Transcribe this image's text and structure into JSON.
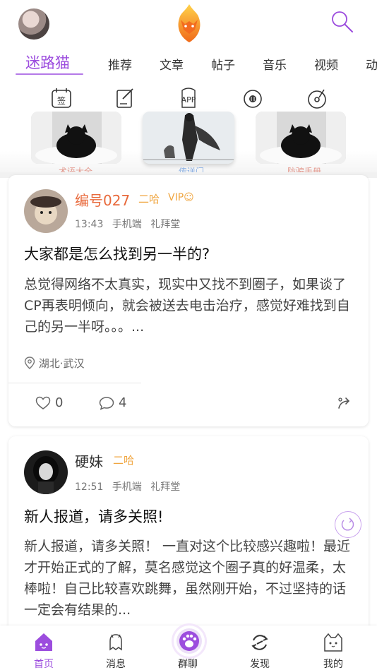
{
  "header": {
    "avatar": "user-avatar",
    "logo": "fox-flame-logo",
    "search": "search-icon"
  },
  "tabs": [
    "迷路猫",
    "推荐",
    "文章",
    "帖子",
    "音乐",
    "视频",
    "动"
  ],
  "quick_icons": [
    {
      "icon": "calendar-sign-icon",
      "text": "签"
    },
    {
      "icon": "edit-note-icon",
      "text": ""
    },
    {
      "icon": "app-icon",
      "text": "APP"
    },
    {
      "icon": "music-disc-icon",
      "text": ""
    },
    {
      "icon": "record-player-icon",
      "text": ""
    }
  ],
  "banners": [
    {
      "label": "术语大全",
      "color": "#e39a8f"
    },
    {
      "label": "传送门",
      "color": "#8fb2e3"
    },
    {
      "label": "防骗手册",
      "color": "#e39a8f"
    }
  ],
  "posts": [
    {
      "author": "编号027",
      "author_color": "#e8693b",
      "level": "二哈",
      "vip": "VIP",
      "time": "13:43",
      "platform": "手机端",
      "channel": "礼拜堂",
      "title": "大家都是怎么找到另一半的?",
      "body": "总觉得网络不太真实，现实中又找不到圈子，如果谈了CP再表明倾向，就会被送去电击治疗，感觉好难找到自己的另一半呀。。。...",
      "location": "湖北·武汉",
      "likes": "0",
      "comments": "4"
    },
    {
      "author": "硬妹",
      "author_color": "#333333",
      "level": "二哈",
      "time": "12:51",
      "platform": "手机端",
      "channel": "礼拜堂",
      "title": "新人报道，请多关照!",
      "body": "新人报道，请多关照！ 一直对这个比较感兴趣啦！最近才开始正式的了解，莫名感觉这个圈子真的好温柔，太棒啦！自己比较喜欢跳舞，虽然刚开始，不过坚持的话一定会有结果的..."
    }
  ],
  "bottom_nav": [
    {
      "label": "首页",
      "icon": "home-cat-icon",
      "active": true
    },
    {
      "label": "消息",
      "icon": "bell-ghost-icon",
      "active": false
    },
    {
      "label": "群聊",
      "icon": "paw-icon",
      "active": false
    },
    {
      "label": "发现",
      "icon": "discover-refresh-icon",
      "active": false
    },
    {
      "label": "我的",
      "icon": "cat-box-icon",
      "active": false
    }
  ],
  "colors": {
    "accent": "#9c4dde",
    "level": "#f0a640",
    "text": "#222222"
  }
}
